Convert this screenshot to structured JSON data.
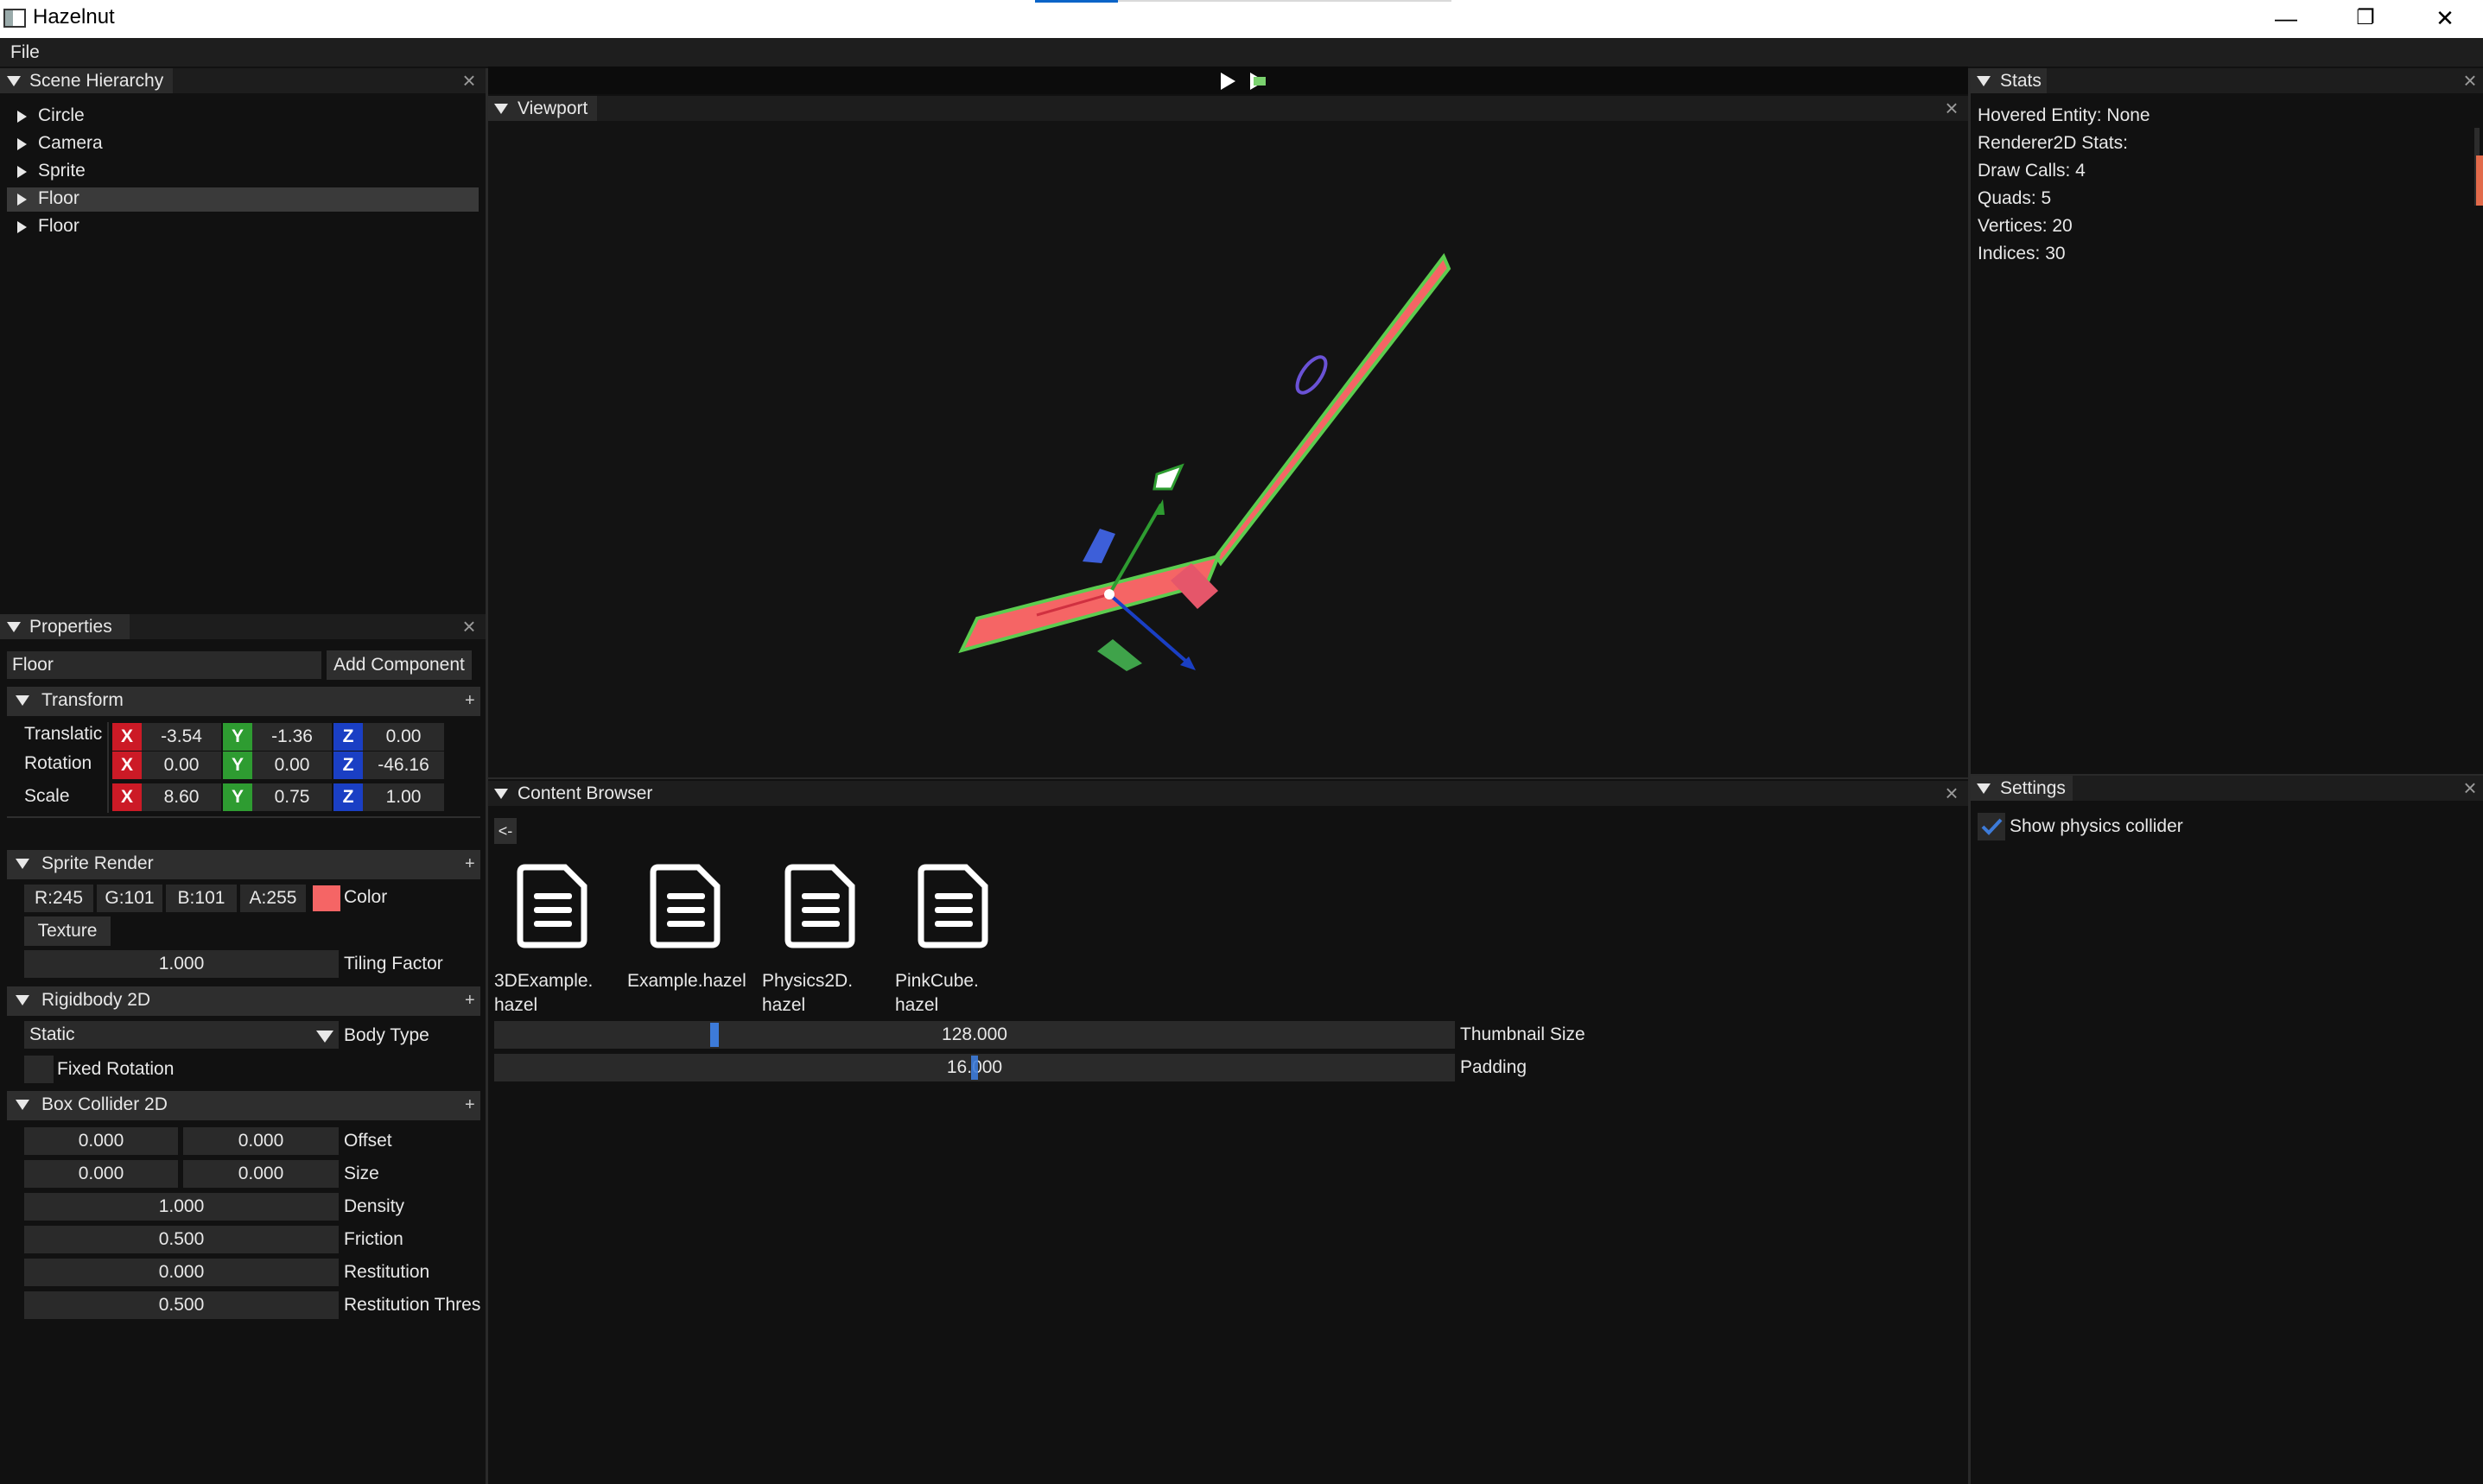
{
  "window": {
    "title": "Hazelnut",
    "minimize_glyph": "—",
    "restore_glyph": "❐",
    "close_glyph": "✕"
  },
  "menu": {
    "file": "File"
  },
  "toolbar": {
    "play_icon": "play-icon",
    "simulate_icon": "simulate-icon"
  },
  "scene_hierarchy": {
    "title": "Scene Hierarchy",
    "items": [
      {
        "label": "Circle"
      },
      {
        "label": "Camera"
      },
      {
        "label": "Sprite"
      },
      {
        "label": "Floor",
        "selected": true
      },
      {
        "label": "Floor"
      }
    ]
  },
  "properties": {
    "title": "Properties",
    "entity_name": "Floor",
    "add_component": "Add Component",
    "transform": {
      "title": "Transform",
      "plus": "+",
      "rows": [
        {
          "label": "Translatic",
          "x": "-3.54",
          "y": "-1.36",
          "z": "0.00"
        },
        {
          "label": "Rotation",
          "x": "0.00",
          "y": "0.00",
          "z": "-46.16"
        },
        {
          "label": "Scale",
          "x": "8.60",
          "y": "0.75",
          "z": "1.00"
        }
      ],
      "axis_x": "X",
      "axis_y": "Y",
      "axis_z": "Z"
    },
    "sprite_renderer": {
      "title": "Sprite Render",
      "plus": "+",
      "r": "R:245",
      "g": "G:101",
      "b": "B:101",
      "a": "A:255",
      "color_label": "Color",
      "color_swatch": "#f56565",
      "texture": "Texture",
      "tiling_value": "1.000",
      "tiling_label": "Tiling Factor"
    },
    "rigidbody": {
      "title": "Rigidbody 2D",
      "plus": "+",
      "body_type_value": "Static",
      "body_type_label": "Body Type",
      "fixed_rotation_label": "Fixed Rotation",
      "fixed_rotation_checked": false
    },
    "box_collider": {
      "title": "Box Collider 2D",
      "plus": "+",
      "offset": [
        "0.000",
        "0.000"
      ],
      "offset_label": "Offset",
      "size": [
        "0.000",
        "0.000"
      ],
      "size_label": "Size",
      "density": "1.000",
      "density_label": "Density",
      "friction": "0.500",
      "friction_label": "Friction",
      "restitution": "0.000",
      "restitution_label": "Restitution",
      "restitution_threshold": "0.500",
      "restitution_threshold_label": "Restitution Thres"
    }
  },
  "viewport": {
    "title": "Viewport"
  },
  "content_browser": {
    "title": "Content Browser",
    "back": "<-",
    "files": [
      {
        "line1": "3DExample.",
        "line2": "hazel"
      },
      {
        "line1": "Example.hazel",
        "line2": ""
      },
      {
        "line1": "Physics2D.",
        "line2": "hazel"
      },
      {
        "line1": "PinkCube.",
        "line2": "hazel"
      }
    ],
    "thumbnail_size_value": "128.000",
    "thumbnail_size_label": "Thumbnail Size",
    "padding_value": "16.000",
    "padding_label": "Padding"
  },
  "stats": {
    "title": "Stats",
    "hovered": "Hovered Entity: None",
    "renderer": "Renderer2D Stats:",
    "draw_calls": "Draw Calls: 4",
    "quads": "Quads: 5",
    "vertices": "Vertices: 20",
    "indices": "Indices: 30"
  },
  "settings": {
    "title": "Settings",
    "show_physics_collider": "Show physics collider",
    "show_physics_collider_checked": true
  },
  "colors": {
    "accent": "#3d7bd9",
    "sprite": "#f56565",
    "collider": "#5ccd4f"
  }
}
